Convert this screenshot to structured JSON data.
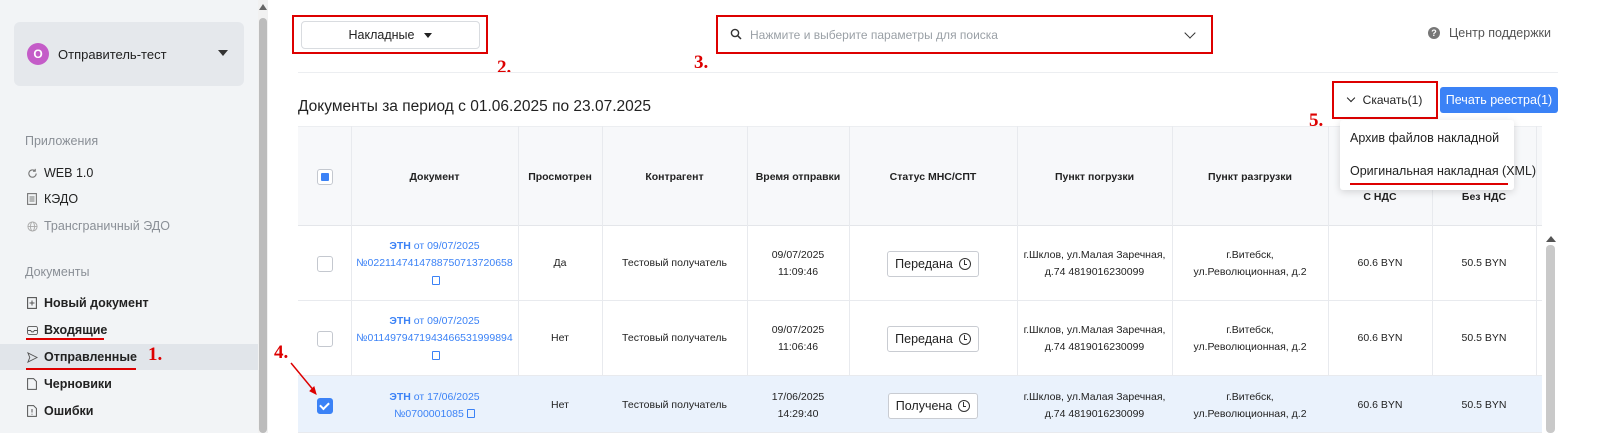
{
  "sidebar": {
    "account": {
      "initial": "О",
      "name": "Отправитель-тест"
    },
    "sections": [
      {
        "label": "Приложения"
      },
      {
        "label": "Документы"
      }
    ],
    "apps": [
      {
        "label": "WEB 1.0",
        "icon": "refresh-icon"
      },
      {
        "label": "КЭДО",
        "icon": "document-icon"
      },
      {
        "label": "Трансграничный ЭДО",
        "icon": "globe-icon"
      }
    ],
    "docs": [
      {
        "label": "Новый документ",
        "icon": "new-document-icon"
      },
      {
        "label": "Входящие",
        "icon": "inbox-icon"
      },
      {
        "label": "Отправленные",
        "icon": "send-icon"
      },
      {
        "label": "Черновики",
        "icon": "draft-icon"
      },
      {
        "label": "Ошибки",
        "icon": "error-document-icon"
      }
    ]
  },
  "annotations": [
    "1.",
    "2.",
    "3.",
    "4.",
    "5."
  ],
  "topbar": {
    "doc_type": "Накладные",
    "search_placeholder": "Нажмите и выберите параметры для поиска",
    "support": "Центр поддержки"
  },
  "period_title": "Документы за период с 01.06.2025 по 23.07.2025",
  "download_button": "Скачать(1)",
  "print_button": "Печать реестра(1)",
  "download_menu": [
    "Архив файлов накладной",
    "Оригинальная накладная (XML)"
  ],
  "table": {
    "headers": [
      "Документ",
      "Просмотрен",
      "Контрагент",
      "Время отправки",
      "Статус МНС/СПТ",
      "Пункт погрузки",
      "Пункт разгрузки",
      "С НДС",
      "Без НДС"
    ],
    "rows": [
      {
        "doc_type": "ЭТН",
        "doc_date": "от 09/07/2025",
        "doc_number": "№0221147414788750713720658",
        "viewed": "Да",
        "counterparty": "Тестовый получатель",
        "sent_date": "09/07/2025",
        "sent_time": "11:09:46",
        "status": "Передана",
        "loading_1": "г.Шклов, ул.Малая Заречная,",
        "loading_2": "д.74 4819016230099",
        "unloading_1": "г.Витебск,",
        "unloading_2": "ул.Революционная, д.2",
        "with_vat": "60.6 BYN",
        "without_vat": "50.5 BYN",
        "checked": false
      },
      {
        "doc_type": "ЭТН",
        "doc_date": "от 09/07/2025",
        "doc_number": "№0114979471943466531999894",
        "viewed": "Нет",
        "counterparty": "Тестовый получатель",
        "sent_date": "09/07/2025",
        "sent_time": "11:06:46",
        "status": "Передана",
        "loading_1": "г.Шклов, ул.Малая Заречная,",
        "loading_2": "д.74 4819016230099",
        "unloading_1": "г.Витебск,",
        "unloading_2": "ул.Революционная, д.2",
        "with_vat": "60.6 BYN",
        "without_vat": "50.5 BYN",
        "checked": false
      },
      {
        "doc_type": "ЭТН",
        "doc_date": "от 17/06/2025",
        "doc_number": "№0700001085",
        "viewed": "Нет",
        "counterparty": "Тестовый получатель",
        "sent_date": "17/06/2025",
        "sent_time": "14:29:40",
        "status": "Получена",
        "loading_1": "г.Шклов, ул.Малая Заречная,",
        "loading_2": "д.74 4819016230099",
        "unloading_1": "г.Витебск,",
        "unloading_2": "ул.Революционная, д.2",
        "with_vat": "60.6 BYN",
        "without_vat": "50.5 BYN",
        "checked": true
      }
    ]
  },
  "colors": {
    "accent": "#3b82f6",
    "annotation": "#dd0000",
    "avatar": "#c45cc8"
  }
}
